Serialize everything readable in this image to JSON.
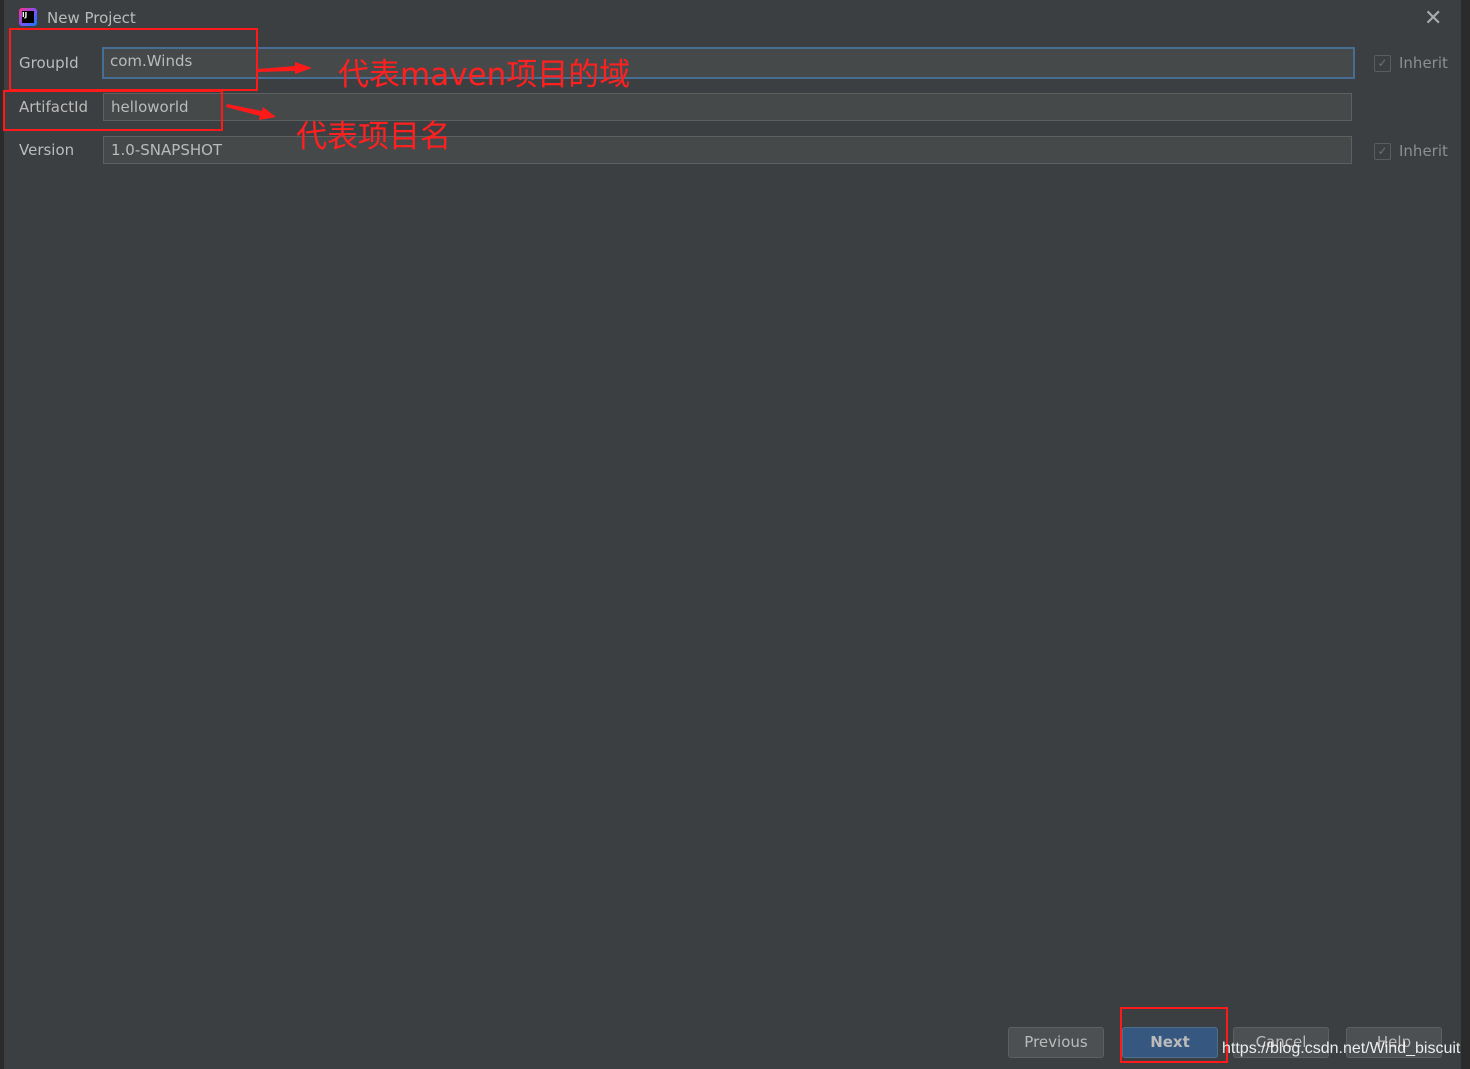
{
  "dialog": {
    "title": "New Project",
    "close_icon": "close-icon"
  },
  "form": {
    "group_id": {
      "label": "GroupId",
      "value": "com.Winds",
      "inherit_label": "Inherit",
      "inherit_checked": true
    },
    "artifact_id": {
      "label": "ArtifactId",
      "value": "helloworld"
    },
    "version": {
      "label": "Version",
      "value": "1.0-SNAPSHOT",
      "inherit_label": "Inherit",
      "inherit_checked": true
    }
  },
  "buttons": {
    "previous": "Previous",
    "next": "Next",
    "cancel": "Cancel",
    "help": "Help"
  },
  "annotations": {
    "group_note": "代表maven项目的域",
    "artifact_note": "代表项目名",
    "color": "#ff1a1a"
  },
  "watermark": "https://blog.csdn.net/Wind_biscuit"
}
